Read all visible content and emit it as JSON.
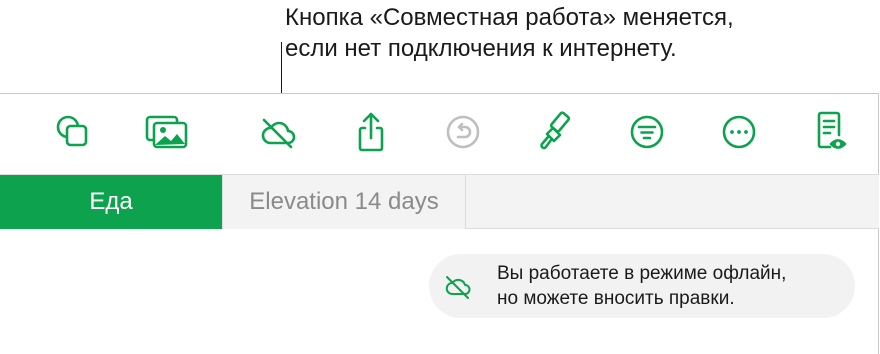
{
  "callout": {
    "line1": "Кнопка «Совместная работа» меняется,",
    "line2": "если нет подключения к интернету."
  },
  "toolbar": {
    "accent_color": "#0ca24e",
    "disabled_color": "#bfbfbf",
    "buttons": [
      {
        "icon": "shapes-icon",
        "state": "enabled"
      },
      {
        "icon": "media-icon",
        "state": "enabled"
      },
      {
        "icon": "cloud-offline-icon",
        "state": "enabled"
      },
      {
        "icon": "share-icon",
        "state": "enabled"
      },
      {
        "icon": "undo-icon",
        "state": "disabled"
      },
      {
        "icon": "format-brush-icon",
        "state": "enabled"
      },
      {
        "icon": "filter-icon",
        "state": "enabled"
      },
      {
        "icon": "more-icon",
        "state": "enabled"
      },
      {
        "icon": "document-view-icon",
        "state": "enabled"
      }
    ]
  },
  "tabs": [
    {
      "label": "Еда",
      "active": true
    },
    {
      "label": "Elevation 14 days",
      "active": false
    }
  ],
  "toast": {
    "icon": "cloud-offline-icon",
    "line1": "Вы работаете в режиме офлайн,",
    "line2": "но можете вносить правки."
  }
}
